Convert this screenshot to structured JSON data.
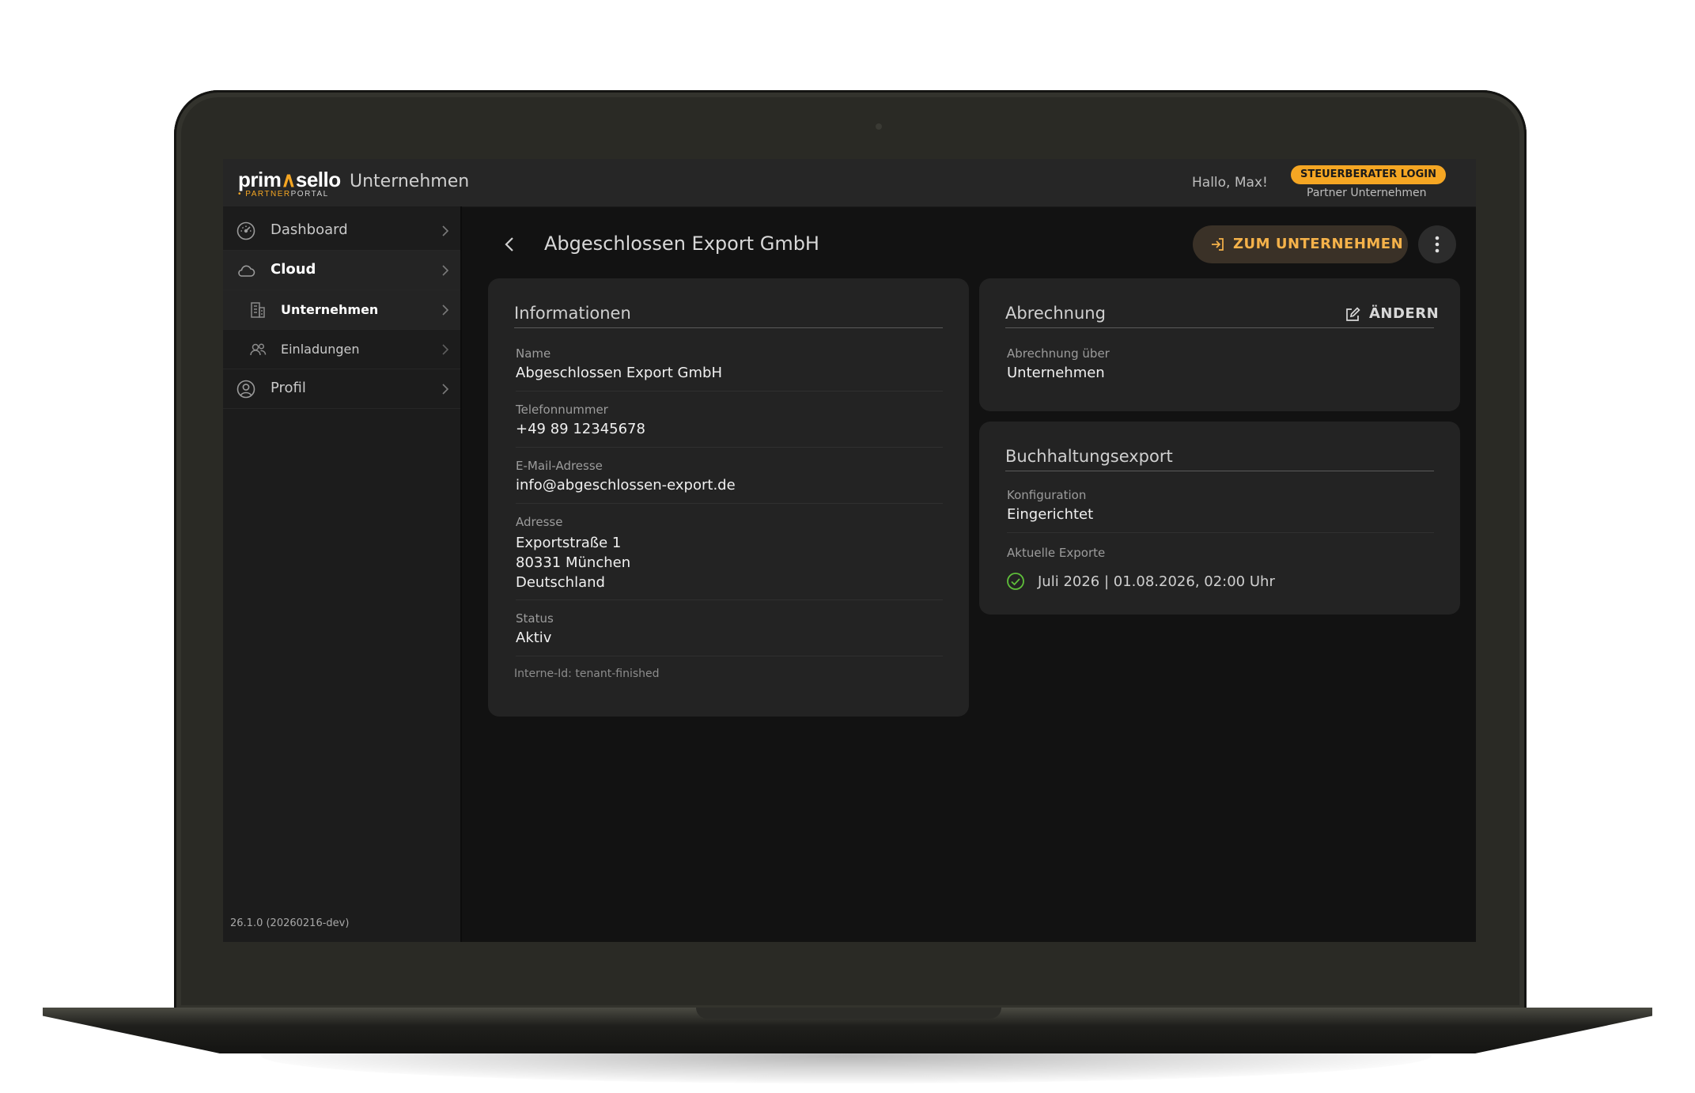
{
  "brand": {
    "logo_left": "prim",
    "logo_mark": "∧",
    "logo_right": "sello",
    "logo_sub_accent": "• PARTNER",
    "logo_sub_rest": "PORTAL",
    "accent_color": "#f5a623"
  },
  "header": {
    "title": "Unternehmen",
    "greeting": "Hallo, Max!",
    "badge": "STEUERBERATER LOGIN",
    "badge_sub": "Partner Unternehmen"
  },
  "sidebar": {
    "items": [
      {
        "label": "Dashboard",
        "icon": "speedometer-icon"
      },
      {
        "label": "Cloud",
        "icon": "cloud-icon"
      },
      {
        "label": "Unternehmen",
        "icon": "building-icon"
      },
      {
        "label": "Einladungen",
        "icon": "users-icon"
      },
      {
        "label": "Profil",
        "icon": "user-circle-icon"
      }
    ],
    "version": "26.1.0 (20260216-dev)"
  },
  "page": {
    "title": "Abgeschlossen Export GmbH",
    "primary_action": "ZUM UNTERNEHMEN"
  },
  "info_card": {
    "title": "Informationen",
    "fields": [
      {
        "label": "Name",
        "value": "Abgeschlossen Export GmbH"
      },
      {
        "label": "Telefonnummer",
        "value": "+49 89 12345678"
      },
      {
        "label": "E-Mail-Adresse",
        "value": "info@abgeschlossen-export.de"
      },
      {
        "label": "Adresse",
        "lines": [
          "Exportstraße 1",
          "80331 München",
          "Deutschland"
        ]
      },
      {
        "label": "Status",
        "value": "Aktiv"
      }
    ],
    "internal_id": "Interne-Id: tenant-finished"
  },
  "billing_card": {
    "title": "Abrechnung",
    "edit_label": "ÄNDERN",
    "field_label": "Abrechnung über",
    "field_value": "Unternehmen"
  },
  "export_card": {
    "title": "Buchhaltungsexport",
    "config_label": "Konfiguration",
    "config_value": "Eingerichtet",
    "exports_label": "Aktuelle Exporte",
    "exports": [
      {
        "text": "Juli 2026 | 01.08.2026, 02:00 Uhr",
        "status": "success",
        "status_color": "#5fbf3a"
      }
    ]
  }
}
